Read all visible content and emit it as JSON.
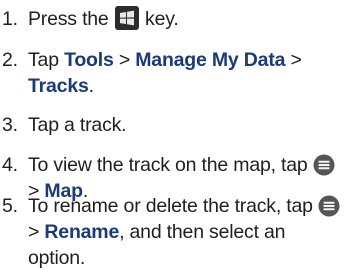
{
  "steps": [
    {
      "number": "1.",
      "parts": {
        "a": "Press the",
        "b": "key."
      },
      "icon": "windows-start-key-icon"
    },
    {
      "number": "2.",
      "parts": {
        "a": "Tap",
        "tools": "Tools",
        "sep1": ">",
        "manage": "Manage My Data",
        "sep2": ">",
        "tracks": "Tracks",
        "end": "."
      }
    },
    {
      "number": "3.",
      "text": "Tap a track."
    },
    {
      "number": "4.",
      "parts": {
        "a": "To view the track on the map, tap",
        "sep": ">",
        "map": "Map",
        "end": "."
      },
      "icon": "menu-key-icon"
    },
    {
      "number": "5.",
      "parts": {
        "a": "To rename or delete the track, tap",
        "sep": ">",
        "rename": "Rename",
        "b": ", and then select an option."
      },
      "icon": "menu-key-icon"
    }
  ],
  "colors": {
    "text": "#1f1f1f",
    "keyword": "#1b3a7a",
    "icon_dark": "#2c2c2c",
    "icon_menu": "#555555"
  }
}
